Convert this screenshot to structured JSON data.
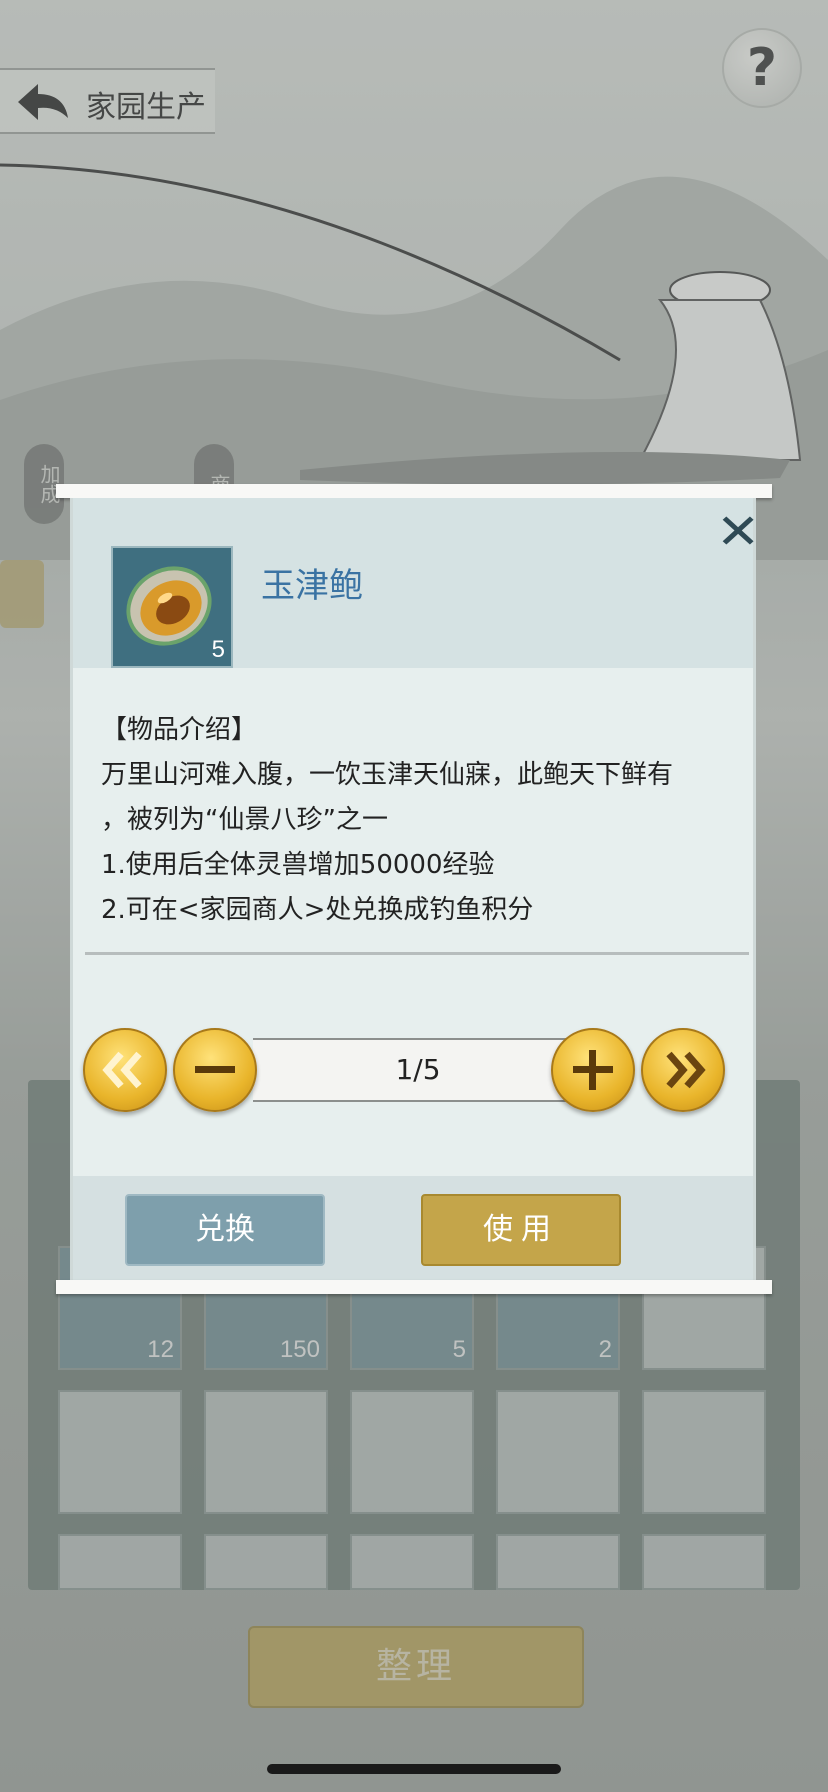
{
  "header": {
    "title": "家园生产",
    "help_label": "?"
  },
  "side_buttons": [
    "加成",
    "商"
  ],
  "inventory": {
    "counts": [
      "12",
      "150",
      "5",
      "2"
    ],
    "sort_label": "整理"
  },
  "dialog": {
    "item_name": "玉津鲍",
    "item_count": "5",
    "close_label": "✕",
    "desc_lines": [
      "【物品介绍】",
      "万里山河难入腹，一饮玉津天仙寐，此鲍天下鲜有",
      "，被列为“仙景八珍”之一",
      "1.使用后全体灵兽增加50000经验",
      "2.可在<家园商人>处兑换成钓鱼积分"
    ],
    "quantity": "1/5",
    "exchange_label": "兑换",
    "use_label": "使用"
  },
  "colors": {
    "item_name": "#3a73a3",
    "gold": "#e9b52b",
    "exchange": "#7e9fac",
    "use": "#c4a54a"
  }
}
